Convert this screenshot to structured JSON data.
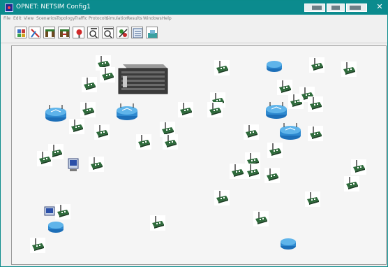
{
  "window": {
    "title": "OPNET: NETSIM Config1",
    "close_glyph": "✕",
    "titlebar_color": "#0b8b8e"
  },
  "menubar": {
    "items": [
      "File",
      "Edit",
      "View",
      "Scenarios",
      "Topology",
      "Traffic",
      "Protocols",
      "Simulation",
      "Results",
      "Windows",
      "Help"
    ]
  },
  "toolbar": {
    "buttons": [
      {
        "name": "open-palette-icon"
      },
      {
        "name": "configure-link-icon"
      },
      {
        "name": "verify-links-icon"
      },
      {
        "name": "fail-link-icon"
      },
      {
        "name": "recover-link-icon"
      },
      {
        "name": "zoom-icon"
      },
      {
        "name": "zoom-out-icon"
      },
      {
        "name": "simulation-icon"
      },
      {
        "name": "view-results-icon"
      },
      {
        "name": "hide-graphs-icon"
      }
    ]
  },
  "canvas": {
    "background": "#f5f5f5",
    "node_types": {
      "workstation": "workstation-icon",
      "router": "router-icon",
      "switch": "switch-icon",
      "server": "server-icon"
    }
  }
}
